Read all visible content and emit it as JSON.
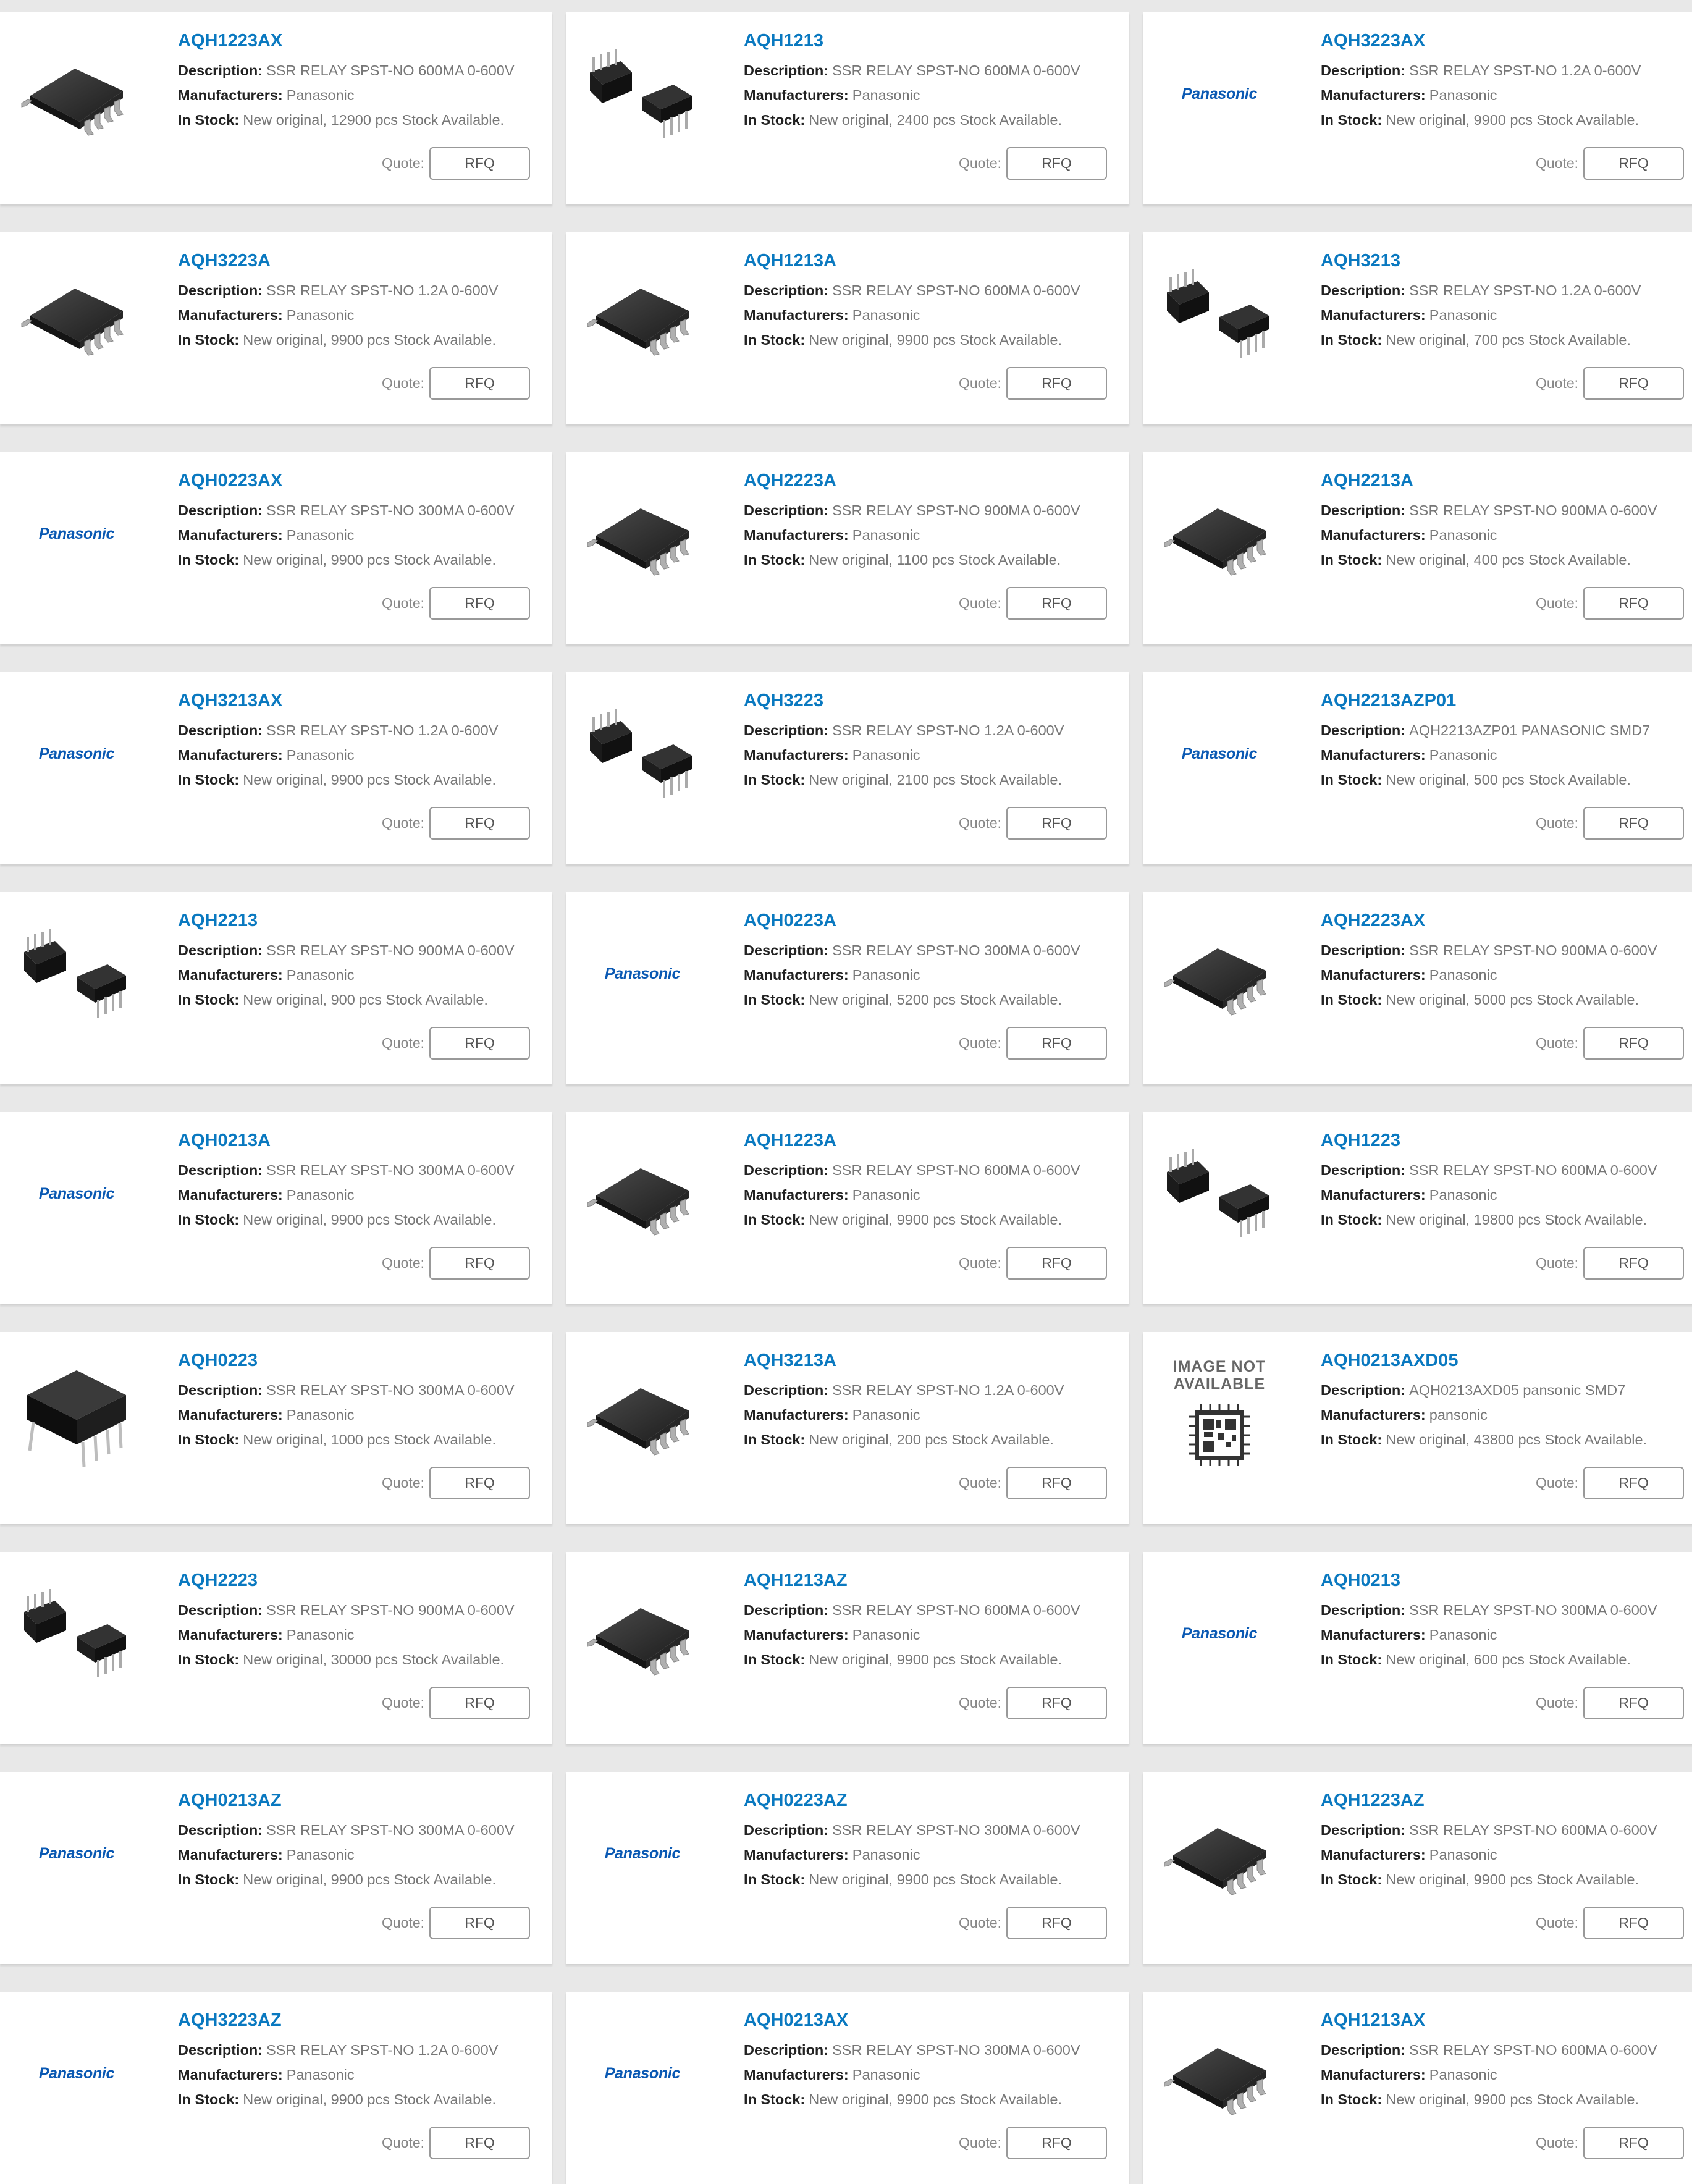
{
  "labels": {
    "description": "Description:",
    "manufacturers": "Manufacturers:",
    "in_stock": "In Stock:",
    "quote": "Quote:",
    "rfq": "RFQ",
    "logo_text": "Panasonic",
    "image_not_available": "IMAGE NOT AVAILABLE"
  },
  "colors": {
    "link": "#0a79c0",
    "logo": "#0a59b3",
    "page_bg": "#e8e8e8",
    "card_bg": "#ffffff"
  },
  "products": [
    {
      "name": "AQH1223AX",
      "description": "SSR RELAY SPST-NO 600MA 0-600V",
      "manufacturer": "Panasonic",
      "stock": "New original, 12900 pcs Stock Available.",
      "image": "soic-package-icon"
    },
    {
      "name": "AQH1213",
      "description": "SSR RELAY SPST-NO 600MA 0-600V",
      "manufacturer": "Panasonic",
      "stock": "New original, 2400 pcs Stock Available.",
      "image": "dip-pair-icon"
    },
    {
      "name": "AQH3223AX",
      "description": "SSR RELAY SPST-NO 1.2A 0-600V",
      "manufacturer": "Panasonic",
      "stock": "New original, 9900 pcs Stock Available.",
      "image": "panasonic-logo"
    },
    {
      "name": "AQH3223A",
      "description": "SSR RELAY SPST-NO 1.2A 0-600V",
      "manufacturer": "Panasonic",
      "stock": "New original, 9900 pcs Stock Available.",
      "image": "soic-package-icon"
    },
    {
      "name": "AQH1213A",
      "description": "SSR RELAY SPST-NO 600MA 0-600V",
      "manufacturer": "Panasonic",
      "stock": "New original, 9900 pcs Stock Available.",
      "image": "soic-package-icon"
    },
    {
      "name": "AQH3213",
      "description": "SSR RELAY SPST-NO 1.2A 0-600V",
      "manufacturer": "Panasonic",
      "stock": "New original, 700 pcs Stock Available.",
      "image": "dip-pair-icon"
    },
    {
      "name": "AQH0223AX",
      "description": "SSR RELAY SPST-NO 300MA 0-600V",
      "manufacturer": "Panasonic",
      "stock": "New original, 9900 pcs Stock Available.",
      "image": "panasonic-logo"
    },
    {
      "name": "AQH2223A",
      "description": "SSR RELAY SPST-NO 900MA 0-600V",
      "manufacturer": "Panasonic",
      "stock": "New original, 1100 pcs Stock Available.",
      "image": "soic-package-icon"
    },
    {
      "name": "AQH2213A",
      "description": "SSR RELAY SPST-NO 900MA 0-600V",
      "manufacturer": "Panasonic",
      "stock": "New original, 400 pcs Stock Available.",
      "image": "soic-package-icon"
    },
    {
      "name": "AQH3213AX",
      "description": "SSR RELAY SPST-NO 1.2A 0-600V",
      "manufacturer": "Panasonic",
      "stock": "New original, 9900 pcs Stock Available.",
      "image": "panasonic-logo"
    },
    {
      "name": "AQH3223",
      "description": "SSR RELAY SPST-NO 1.2A 0-600V",
      "manufacturer": "Panasonic",
      "stock": "New original, 2100 pcs Stock Available.",
      "image": "dip-pair-icon"
    },
    {
      "name": "AQH2213AZP01",
      "description": "AQH2213AZP01 PANASONIC SMD7",
      "manufacturer": "Panasonic",
      "stock": "New original, 500 pcs Stock Available.",
      "image": "panasonic-logo"
    },
    {
      "name": "AQH2213",
      "description": "SSR RELAY SPST-NO 900MA 0-600V",
      "manufacturer": "Panasonic",
      "stock": "New original, 900 pcs Stock Available.",
      "image": "dip-pair-icon"
    },
    {
      "name": "AQH0223A",
      "description": "SSR RELAY SPST-NO 300MA 0-600V",
      "manufacturer": "Panasonic",
      "stock": "New original, 5200 pcs Stock Available.",
      "image": "panasonic-logo"
    },
    {
      "name": "AQH2223AX",
      "description": "SSR RELAY SPST-NO 900MA 0-600V",
      "manufacturer": "Panasonic",
      "stock": "New original, 5000 pcs Stock Available.",
      "image": "soic-package-icon"
    },
    {
      "name": "AQH0213A",
      "description": "SSR RELAY SPST-NO 300MA 0-600V",
      "manufacturer": "Panasonic",
      "stock": "New original, 9900 pcs Stock Available.",
      "image": "panasonic-logo"
    },
    {
      "name": "AQH1223A",
      "description": "SSR RELAY SPST-NO 600MA 0-600V",
      "manufacturer": "Panasonic",
      "stock": "New original, 9900 pcs Stock Available.",
      "image": "soic-package-icon"
    },
    {
      "name": "AQH1223",
      "description": "SSR RELAY SPST-NO 600MA 0-600V",
      "manufacturer": "Panasonic",
      "stock": "New original, 19800 pcs Stock Available.",
      "image": "dip-pair-icon"
    },
    {
      "name": "AQH0223",
      "description": "SSR RELAY SPST-NO 300MA 0-600V",
      "manufacturer": "Panasonic",
      "stock": "New original, 1000 pcs Stock Available.",
      "image": "dip-large-icon"
    },
    {
      "name": "AQH3213A",
      "description": "SSR RELAY SPST-NO 1.2A 0-600V",
      "manufacturer": "Panasonic",
      "stock": "New original, 200 pcs Stock Available.",
      "image": "soic-package-icon"
    },
    {
      "name": "AQH0213AXD05",
      "description": "AQH0213AXD05 pansonic SMD7",
      "manufacturer": "pansonic",
      "stock": "New original, 43800 pcs Stock Available.",
      "image": "image-not-available"
    },
    {
      "name": "AQH2223",
      "description": "SSR RELAY SPST-NO 900MA 0-600V",
      "manufacturer": "Panasonic",
      "stock": "New original, 30000 pcs Stock Available.",
      "image": "dip-pair-icon"
    },
    {
      "name": "AQH1213AZ",
      "description": "SSR RELAY SPST-NO 600MA 0-600V",
      "manufacturer": "Panasonic",
      "stock": "New original, 9900 pcs Stock Available.",
      "image": "soic-package-icon"
    },
    {
      "name": "AQH0213",
      "description": "SSR RELAY SPST-NO 300MA 0-600V",
      "manufacturer": "Panasonic",
      "stock": "New original, 600 pcs Stock Available.",
      "image": "panasonic-logo"
    },
    {
      "name": "AQH0213AZ",
      "description": "SSR RELAY SPST-NO 300MA 0-600V",
      "manufacturer": "Panasonic",
      "stock": "New original, 9900 pcs Stock Available.",
      "image": "panasonic-logo"
    },
    {
      "name": "AQH0223AZ",
      "description": "SSR RELAY SPST-NO 300MA 0-600V",
      "manufacturer": "Panasonic",
      "stock": "New original, 9900 pcs Stock Available.",
      "image": "panasonic-logo"
    },
    {
      "name": "AQH1223AZ",
      "description": "SSR RELAY SPST-NO 600MA 0-600V",
      "manufacturer": "Panasonic",
      "stock": "New original, 9900 pcs Stock Available.",
      "image": "soic-package-icon"
    },
    {
      "name": "AQH3223AZ",
      "description": "SSR RELAY SPST-NO 1.2A 0-600V",
      "manufacturer": "Panasonic",
      "stock": "New original, 9900 pcs Stock Available.",
      "image": "panasonic-logo"
    },
    {
      "name": "AQH0213AX",
      "description": "SSR RELAY SPST-NO 300MA 0-600V",
      "manufacturer": "Panasonic",
      "stock": "New original, 9900 pcs Stock Available.",
      "image": "panasonic-logo"
    },
    {
      "name": "AQH1213AX",
      "description": "SSR RELAY SPST-NO 600MA 0-600V",
      "manufacturer": "Panasonic",
      "stock": "New original, 9900 pcs Stock Available.",
      "image": "soic-package-icon"
    }
  ]
}
